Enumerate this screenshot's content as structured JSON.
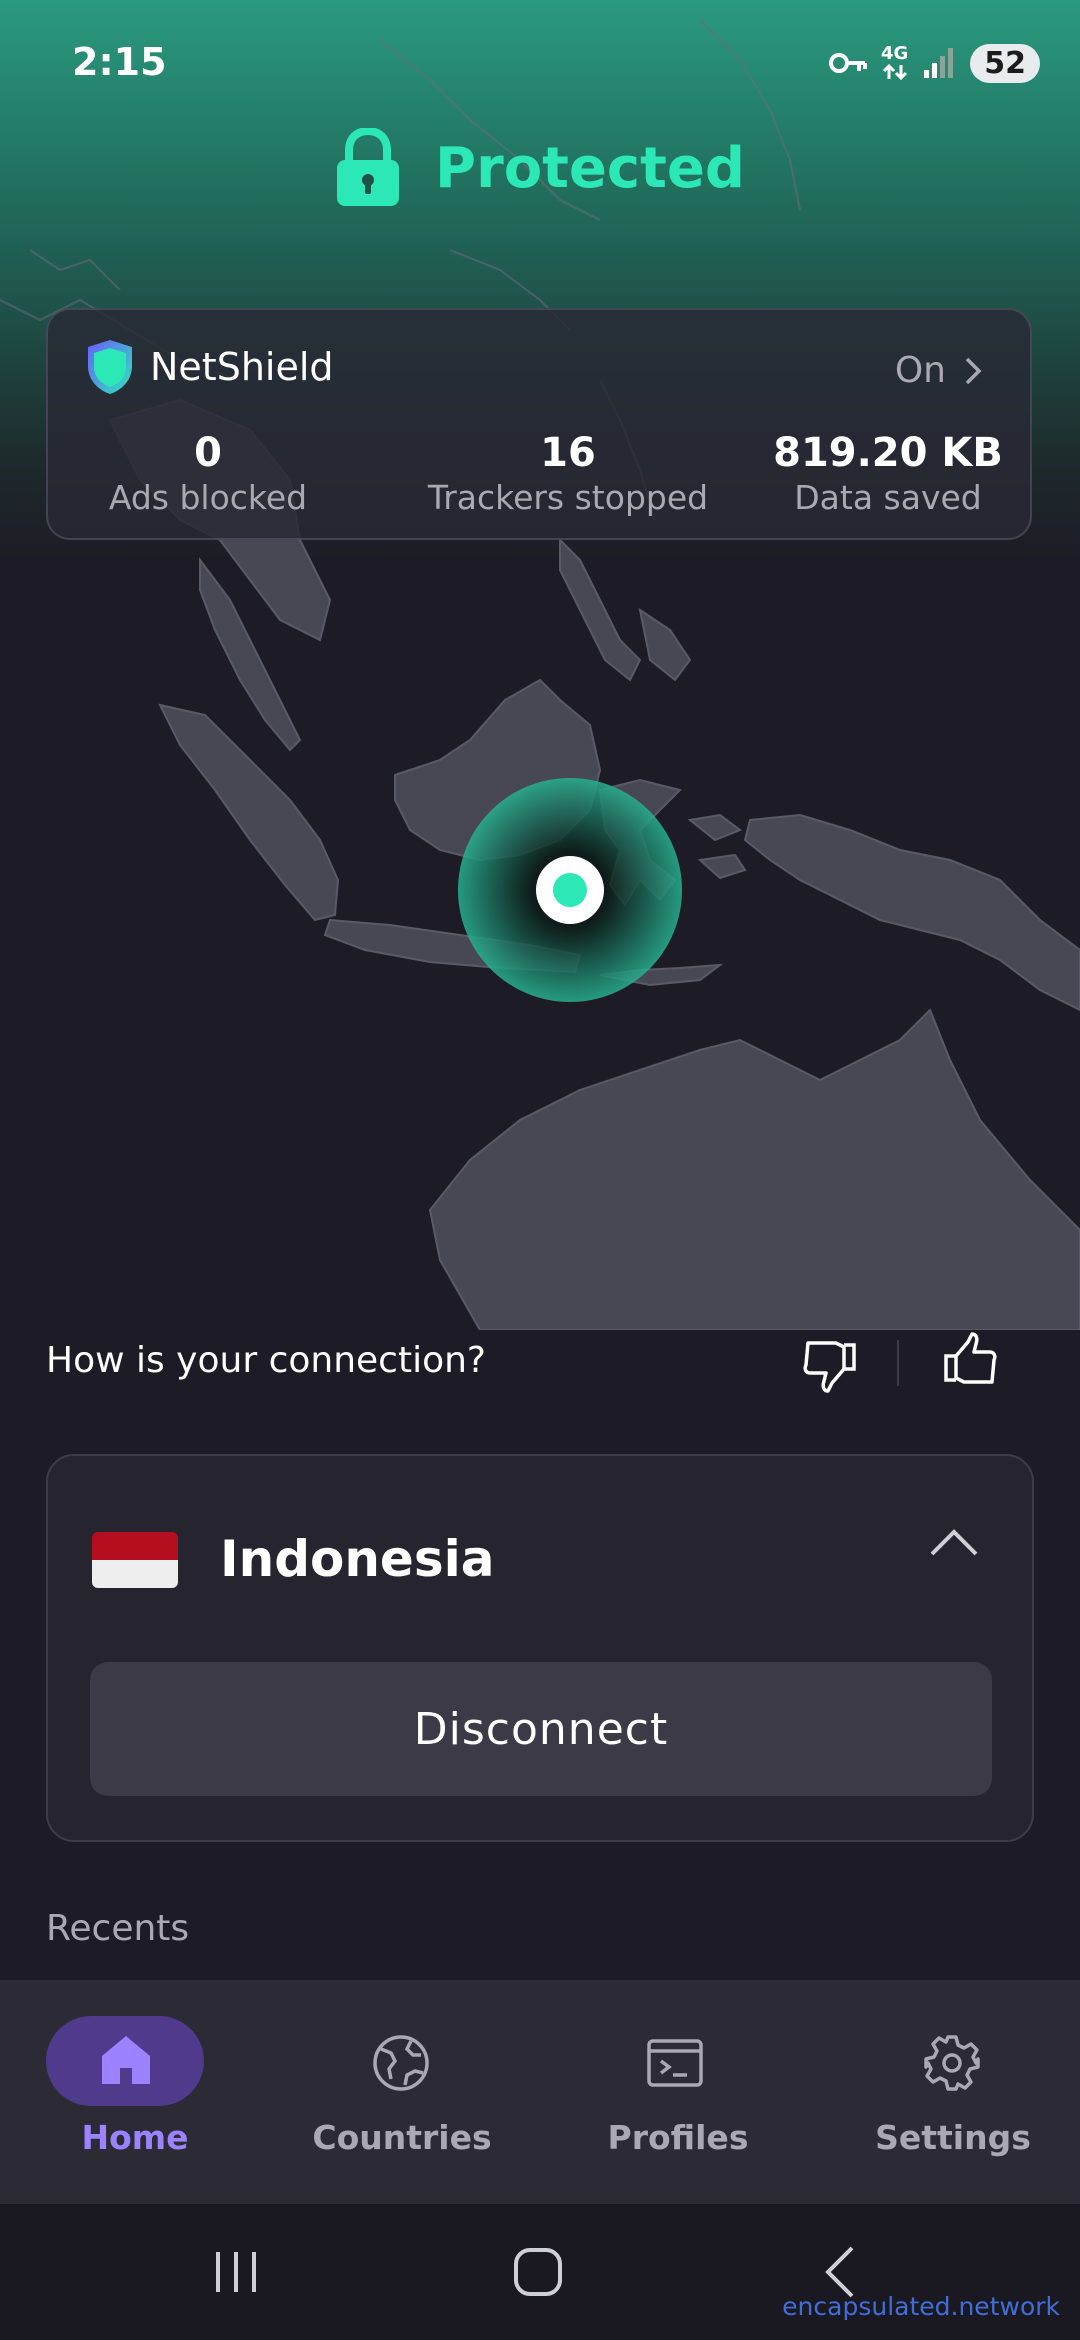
{
  "status_bar": {
    "time": "2:15",
    "network": "4G",
    "battery": "52"
  },
  "header": {
    "title": "Protected",
    "accent_color": "#2ce8b7"
  },
  "netshield": {
    "title": "NetShield",
    "status": "On",
    "stats": [
      {
        "value": "0",
        "label": "Ads blocked"
      },
      {
        "value": "16",
        "label": "Trackers stopped"
      },
      {
        "value": "819.20 KB",
        "label": "Data saved"
      }
    ]
  },
  "feedback": {
    "question": "How is your connection?"
  },
  "connection": {
    "country": "Indonesia",
    "disconnect_label": "Disconnect"
  },
  "recents": {
    "label": "Recents"
  },
  "bottom_nav": {
    "items": [
      {
        "label": "Home",
        "icon": "home-icon",
        "active": true
      },
      {
        "label": "Countries",
        "icon": "globe-icon",
        "active": false
      },
      {
        "label": "Profiles",
        "icon": "terminal-icon",
        "active": false
      },
      {
        "label": "Settings",
        "icon": "gear-icon",
        "active": false
      }
    ],
    "active_color": "#9d82ff"
  },
  "watermark": "encapsulated.network"
}
